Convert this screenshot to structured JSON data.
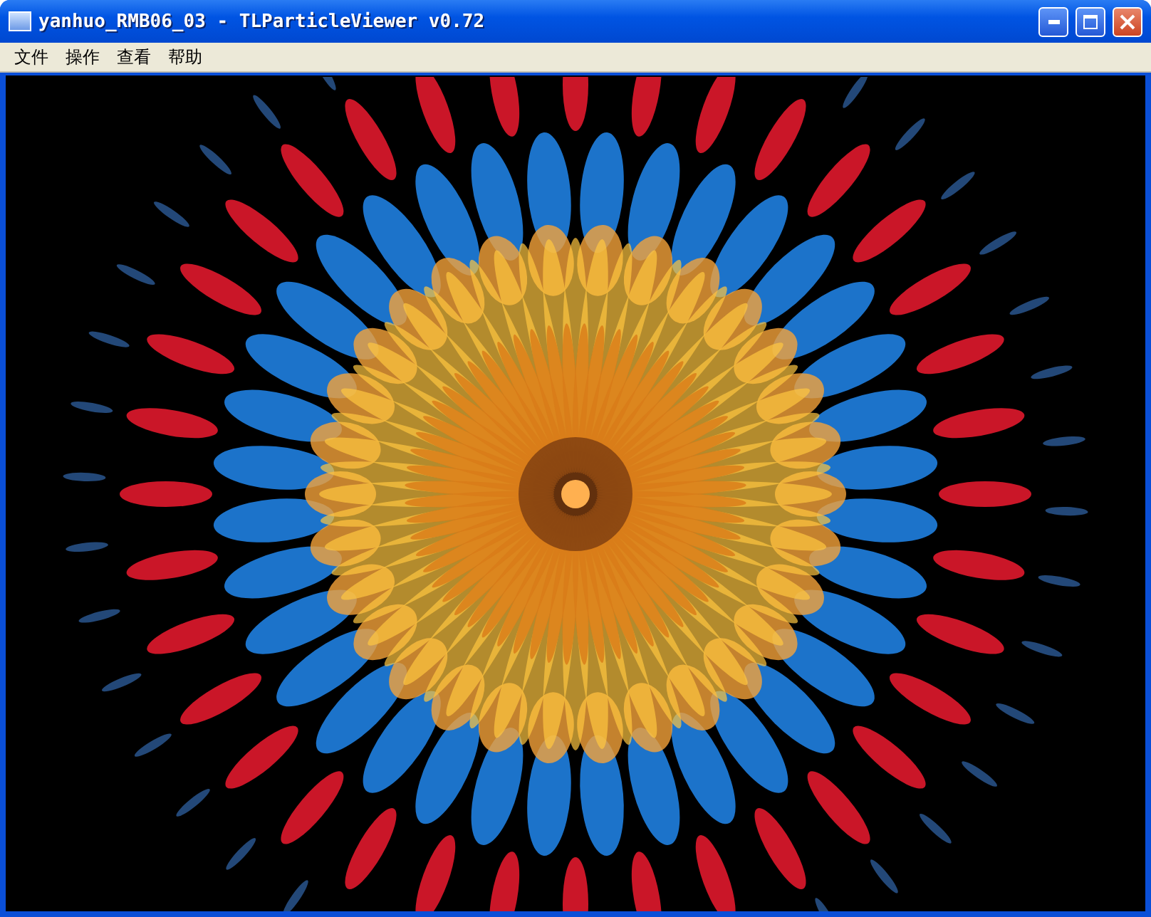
{
  "window": {
    "title": "yanhuo_RMB06_03 - TLParticleViewer v0.72"
  },
  "menu": [
    {
      "label": "文件"
    },
    {
      "label": "操作"
    },
    {
      "label": "查看"
    },
    {
      "label": "帮助"
    }
  ]
}
